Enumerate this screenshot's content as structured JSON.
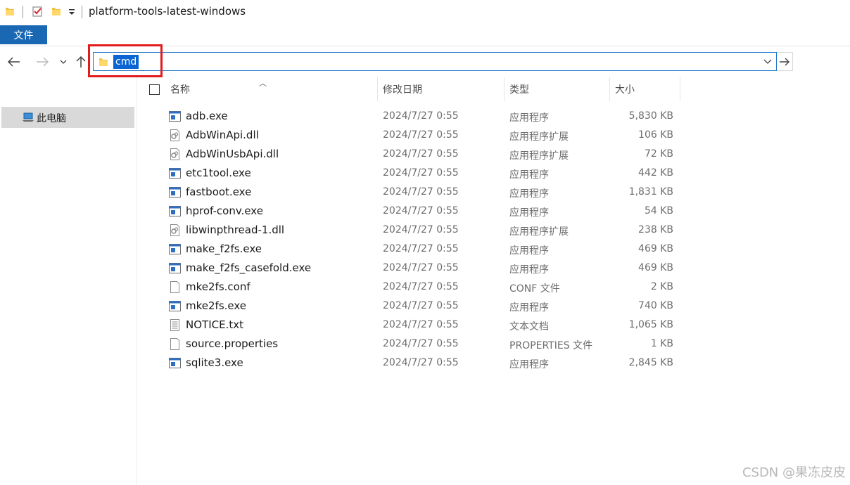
{
  "window": {
    "title": "platform-tools-latest-windows"
  },
  "ribbon": {
    "file_tab": "文件"
  },
  "address_bar": {
    "value": "cmd"
  },
  "sidebar": {
    "items": [
      {
        "label": "此电脑",
        "icon": "computer-icon"
      }
    ]
  },
  "columns": {
    "name": "名称",
    "date": "修改日期",
    "type": "类型",
    "size": "大小"
  },
  "files": [
    {
      "name": "adb.exe",
      "date": "2024/7/27 0:55",
      "type": "应用程序",
      "size": "5,830 KB",
      "icon": "exe"
    },
    {
      "name": "AdbWinApi.dll",
      "date": "2024/7/27 0:55",
      "type": "应用程序扩展",
      "size": "106 KB",
      "icon": "dll"
    },
    {
      "name": "AdbWinUsbApi.dll",
      "date": "2024/7/27 0:55",
      "type": "应用程序扩展",
      "size": "72 KB",
      "icon": "dll"
    },
    {
      "name": "etc1tool.exe",
      "date": "2024/7/27 0:55",
      "type": "应用程序",
      "size": "442 KB",
      "icon": "exe"
    },
    {
      "name": "fastboot.exe",
      "date": "2024/7/27 0:55",
      "type": "应用程序",
      "size": "1,831 KB",
      "icon": "exe"
    },
    {
      "name": "hprof-conv.exe",
      "date": "2024/7/27 0:55",
      "type": "应用程序",
      "size": "54 KB",
      "icon": "exe"
    },
    {
      "name": "libwinpthread-1.dll",
      "date": "2024/7/27 0:55",
      "type": "应用程序扩展",
      "size": "238 KB",
      "icon": "dll"
    },
    {
      "name": "make_f2fs.exe",
      "date": "2024/7/27 0:55",
      "type": "应用程序",
      "size": "469 KB",
      "icon": "exe"
    },
    {
      "name": "make_f2fs_casefold.exe",
      "date": "2024/7/27 0:55",
      "type": "应用程序",
      "size": "469 KB",
      "icon": "exe"
    },
    {
      "name": "mke2fs.conf",
      "date": "2024/7/27 0:55",
      "type": "CONF 文件",
      "size": "2 KB",
      "icon": "file"
    },
    {
      "name": "mke2fs.exe",
      "date": "2024/7/27 0:55",
      "type": "应用程序",
      "size": "740 KB",
      "icon": "exe"
    },
    {
      "name": "NOTICE.txt",
      "date": "2024/7/27 0:55",
      "type": "文本文档",
      "size": "1,065 KB",
      "icon": "txt"
    },
    {
      "name": "source.properties",
      "date": "2024/7/27 0:55",
      "type": "PROPERTIES 文件",
      "size": "1 KB",
      "icon": "file"
    },
    {
      "name": "sqlite3.exe",
      "date": "2024/7/27 0:55",
      "type": "应用程序",
      "size": "2,845 KB",
      "icon": "exe"
    }
  ],
  "watermark": "CSDN @果冻皮皮",
  "colors": {
    "accent": "#1a68b4",
    "selection": "#0a64d4",
    "highlight_box": "#e21b1b",
    "sidebar_selected": "#d9d9d9"
  }
}
